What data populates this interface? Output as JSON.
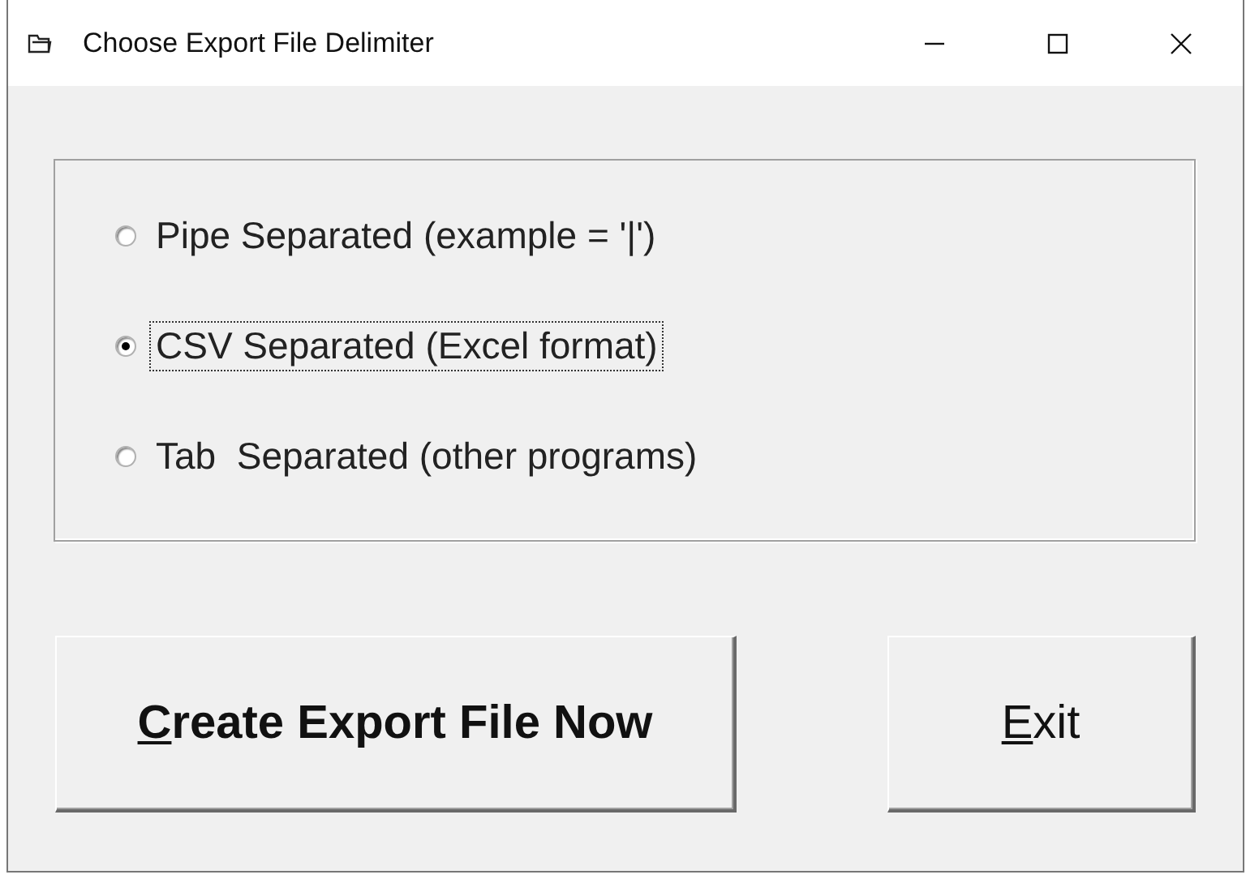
{
  "window": {
    "title": "Choose Export File Delimiter"
  },
  "options": [
    {
      "label": "Pipe Separated (example = '|')",
      "selected": false
    },
    {
      "label": "CSV Separated (Excel format)",
      "selected": true
    },
    {
      "label": "Tab  Separated (other programs)",
      "selected": false
    }
  ],
  "buttons": [
    {
      "kind": "wide",
      "mnemonic": "C",
      "rest": "reate Export File Now"
    },
    {
      "kind": "narrow",
      "mnemonic": "E",
      "rest": "xit"
    }
  ]
}
